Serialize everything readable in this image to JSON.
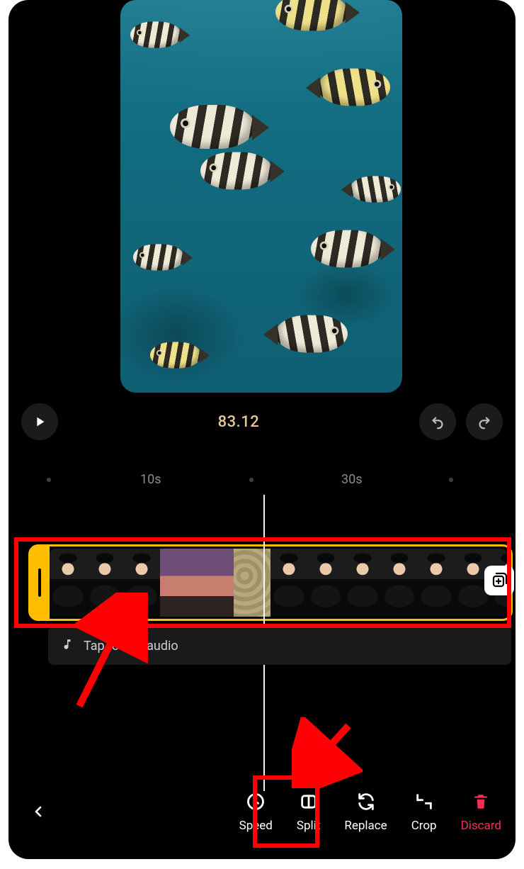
{
  "preview": {
    "alt": "Underwater fish video preview"
  },
  "transport": {
    "timecode": "83.12"
  },
  "ruler": {
    "labels": [
      "10s",
      "30s"
    ]
  },
  "audio": {
    "hint": "Tap to add audio"
  },
  "toolbar": {
    "items": [
      {
        "key": "speed",
        "label": "Speed"
      },
      {
        "key": "split",
        "label": "Split"
      },
      {
        "key": "replace",
        "label": "Replace"
      },
      {
        "key": "crop",
        "label": "Crop"
      },
      {
        "key": "discard",
        "label": "Discard"
      }
    ]
  }
}
